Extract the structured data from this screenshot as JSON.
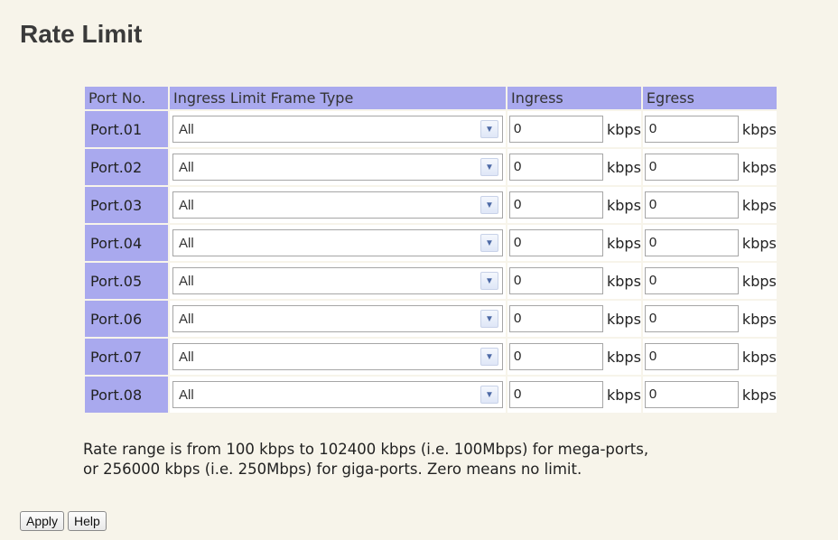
{
  "page": {
    "title": "Rate Limit"
  },
  "table": {
    "headers": {
      "port_no": "Port No.",
      "frame_type": "Ingress Limit Frame Type",
      "ingress": "Ingress",
      "egress": "Egress"
    },
    "unit": "kbps",
    "rows": [
      {
        "port": "Port.01",
        "frame_type": "All",
        "ingress": "0",
        "egress": "0"
      },
      {
        "port": "Port.02",
        "frame_type": "All",
        "ingress": "0",
        "egress": "0"
      },
      {
        "port": "Port.03",
        "frame_type": "All",
        "ingress": "0",
        "egress": "0"
      },
      {
        "port": "Port.04",
        "frame_type": "All",
        "ingress": "0",
        "egress": "0"
      },
      {
        "port": "Port.05",
        "frame_type": "All",
        "ingress": "0",
        "egress": "0"
      },
      {
        "port": "Port.06",
        "frame_type": "All",
        "ingress": "0",
        "egress": "0"
      },
      {
        "port": "Port.07",
        "frame_type": "All",
        "ingress": "0",
        "egress": "0"
      },
      {
        "port": "Port.08",
        "frame_type": "All",
        "ingress": "0",
        "egress": "0"
      }
    ]
  },
  "note": {
    "line1": "Rate range is from 100 kbps to 102400 kbps (i.e. 100Mbps) for mega-ports,",
    "line2": "or 256000 kbps (i.e. 250Mbps) for giga-ports. Zero means no limit."
  },
  "buttons": {
    "apply": "Apply",
    "help": "Help"
  },
  "icons": {
    "dropdown": "chevron-down-icon"
  },
  "colors": {
    "header_bg": "#a9a9ee",
    "page_bg": "#f7f4ea"
  }
}
